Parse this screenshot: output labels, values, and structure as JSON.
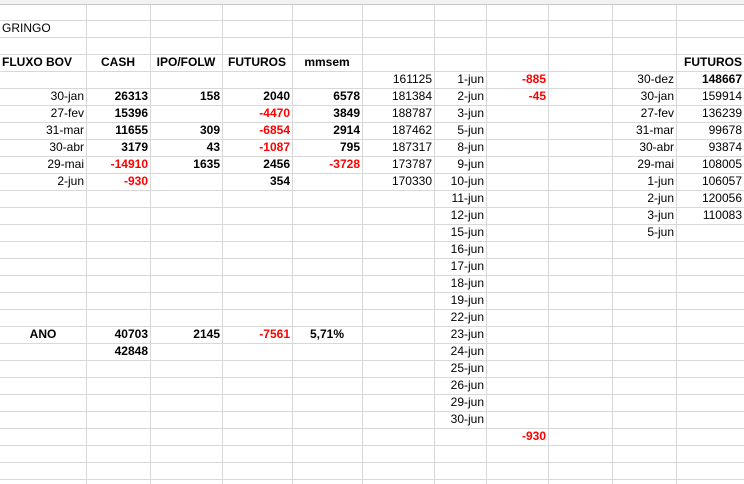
{
  "sheet_title": "GRINGO",
  "headers": {
    "fluxo_bov": "FLUXO BOV",
    "cash": "CASH",
    "ipo_folw": "IPO/FOLW",
    "futuros": "FUTUROS",
    "mmsem": "mmsem",
    "futuros_right": "FUTUROS"
  },
  "main_table": [
    {
      "date": "30-jan",
      "cash": "26313",
      "ipo": "158",
      "fut": "2040",
      "mm": "6578",
      "idx": "181384"
    },
    {
      "date": "27-fev",
      "cash": "15396",
      "ipo": "",
      "fut": "-4470",
      "mm": "3849",
      "idx": "188787"
    },
    {
      "date": "31-mar",
      "cash": "11655",
      "ipo": "309",
      "fut": "-6854",
      "mm": "2914",
      "idx": "187462"
    },
    {
      "date": "30-abr",
      "cash": "3179",
      "ipo": "43",
      "fut": "-1087",
      "mm": "795",
      "idx": "187317"
    },
    {
      "date": "29-mai",
      "cash": "-14910",
      "ipo": "1635",
      "fut": "2456",
      "mm": "-3728",
      "idx": "173787"
    },
    {
      "date": "2-jun",
      "cash": "-930",
      "ipo": "",
      "fut": "354",
      "mm": "",
      "idx": "170330"
    }
  ],
  "idx_first": "161125",
  "june_dates": [
    "1-jun",
    "2-jun",
    "3-jun",
    "5-jun",
    "8-jun",
    "9-jun",
    "10-jun",
    "11-jun",
    "12-jun",
    "15-jun",
    "16-jun",
    "17-jun",
    "18-jun",
    "19-jun",
    "22-jun",
    "23-jun",
    "24-jun",
    "25-jun",
    "26-jun",
    "29-jun",
    "30-jun"
  ],
  "june_values": [
    "-885",
    "-45"
  ],
  "june_total": "-930",
  "ano": {
    "label": "ANO",
    "cash": "40703",
    "cash2": "42848",
    "ipo": "2145",
    "fut": "-7561",
    "mm": "5,71%"
  },
  "right_table": [
    {
      "date": "30-dez",
      "val": "148667"
    },
    {
      "date": "30-jan",
      "val": "159914"
    },
    {
      "date": "27-fev",
      "val": "136239"
    },
    {
      "date": "31-mar",
      "val": "99678"
    },
    {
      "date": "30-abr",
      "val": "93874"
    },
    {
      "date": "29-mai",
      "val": "108005"
    },
    {
      "date": "1-jun",
      "val": "106057"
    },
    {
      "date": "2-jun",
      "val": "120056"
    },
    {
      "date": "3-jun",
      "val": "110083"
    },
    {
      "date": "5-jun",
      "val": ""
    }
  ],
  "colors": {
    "negative": "#ff0000",
    "gridline": "#d8d8d8"
  }
}
